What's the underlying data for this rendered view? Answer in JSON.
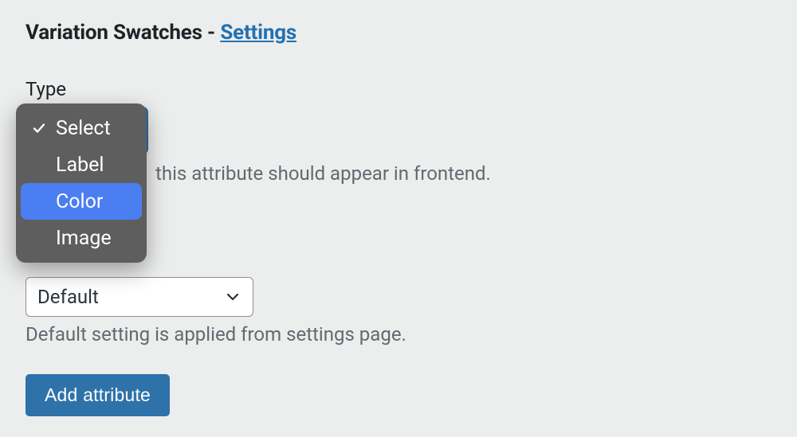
{
  "heading": {
    "prefix": "Variation Swatches - ",
    "link": "Settings"
  },
  "type_field": {
    "label": "Type",
    "description_fragment": "this attribute should appear in frontend."
  },
  "second_select": {
    "value": "Default",
    "helper": "Default setting is applied from settings page."
  },
  "button": {
    "label": "Add attribute"
  },
  "dropdown": {
    "items": [
      {
        "label": "Select",
        "checked": true,
        "highlighted": false
      },
      {
        "label": "Label",
        "checked": false,
        "highlighted": false
      },
      {
        "label": "Color",
        "checked": false,
        "highlighted": true
      },
      {
        "label": "Image",
        "checked": false,
        "highlighted": false
      }
    ]
  }
}
